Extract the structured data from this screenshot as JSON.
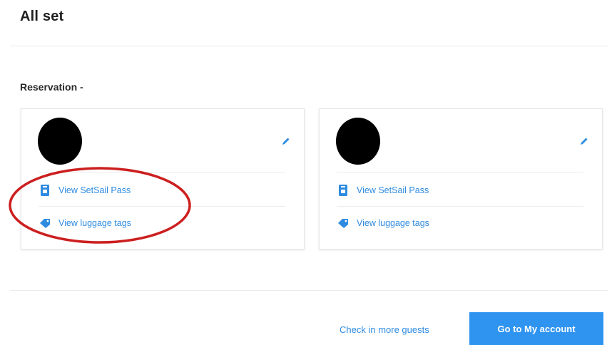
{
  "page": {
    "title": "All set"
  },
  "reservation": {
    "label": "Reservation -"
  },
  "guests": [
    {
      "avatar_color": "#000000",
      "links": [
        {
          "label": "View SetSail Pass",
          "icon": "pass-icon"
        },
        {
          "label": "View luggage tags",
          "icon": "tag-icon"
        }
      ]
    },
    {
      "avatar_color": "#000000",
      "links": [
        {
          "label": "View SetSail Pass",
          "icon": "pass-icon"
        },
        {
          "label": "View luggage tags",
          "icon": "tag-icon"
        }
      ]
    }
  ],
  "footer": {
    "check_in_more_label": "Check in more guests",
    "go_to_account_label": "Go to My account"
  },
  "colors": {
    "accent": "#2f8be0",
    "button": "#2f94f0",
    "highlight": "#cc1f1f"
  }
}
